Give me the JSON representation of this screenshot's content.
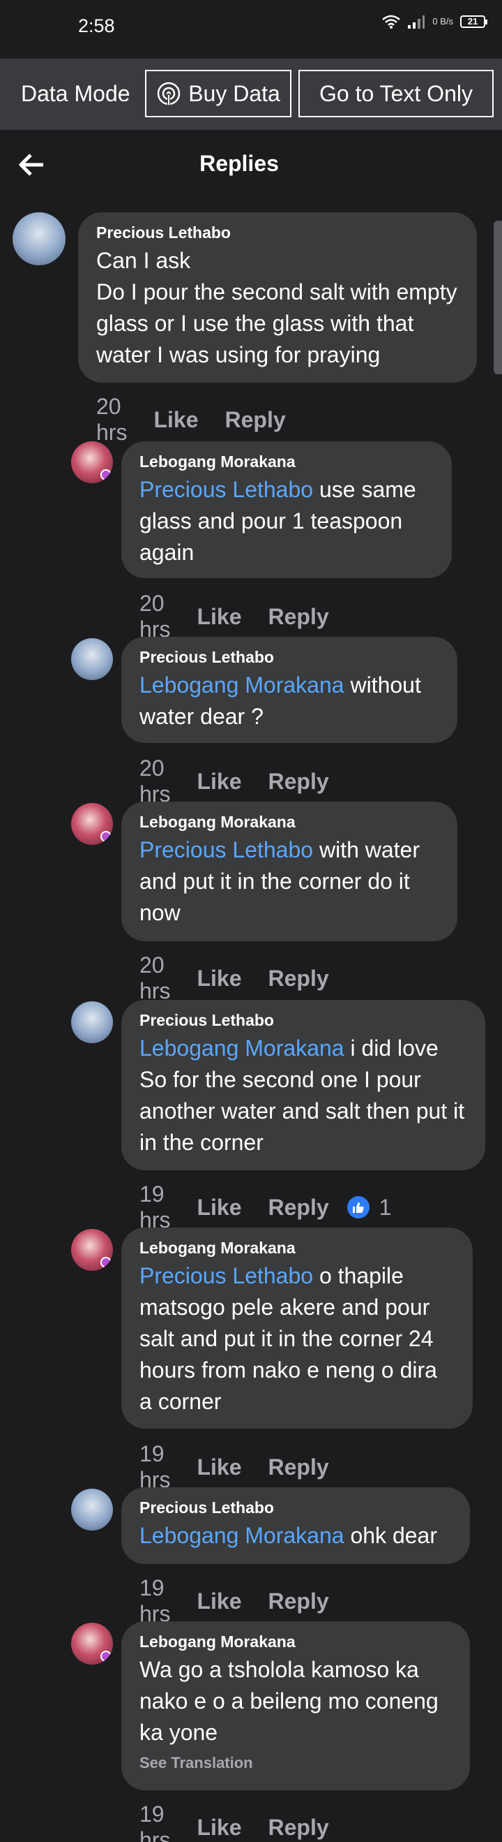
{
  "status_bar": {
    "time": "2:58",
    "net_speed": "0 B/s",
    "battery": "21"
  },
  "data_bar": {
    "mode_label": "Data Mode",
    "buy_data": "Buy Data",
    "text_only": "Go to Text Only"
  },
  "header": {
    "title": "Replies"
  },
  "comments": [
    {
      "author": "Precious Lethabo",
      "mention": "",
      "text_lines": [
        "Can I ask",
        "Do I pour the second salt with empty glass or I use the glass with that water I was using for praying"
      ],
      "time": "20 hrs",
      "like": "Like",
      "reply": "Reply"
    },
    {
      "author": "Lebogang Morakana",
      "mention": "Precious Lethabo",
      "text": " use same glass and pour 1 teaspoon again",
      "time": "20 hrs",
      "like": "Like",
      "reply": "Reply"
    },
    {
      "author": "Precious Lethabo",
      "mention": "Lebogang Morakana",
      "text": " without water dear ?",
      "time": "20 hrs",
      "like": "Like",
      "reply": "Reply"
    },
    {
      "author": "Lebogang Morakana",
      "mention": "Precious Lethabo",
      "text": " with water and put it in the corner do it now",
      "time": "20 hrs",
      "like": "Like",
      "reply": "Reply"
    },
    {
      "author": "Precious Lethabo",
      "mention": "Lebogang Morakana",
      "text": " i did love",
      "text2": "So for the second one I pour another water and salt then put it in the corner",
      "time": "19 hrs",
      "like": "Like",
      "reply": "Reply",
      "reaction_count": "1"
    },
    {
      "author": "Lebogang Morakana",
      "mention": "Precious Lethabo",
      "text": " o thapile matsogo pele akere and pour salt and put it in the corner 24 hours from nako e neng o dira a corner",
      "time": "19 hrs",
      "like": "Like",
      "reply": "Reply"
    },
    {
      "author": "Precious Lethabo",
      "mention": "Lebogang Morakana",
      "text": " ohk dear",
      "time": "19 hrs",
      "like": "Like",
      "reply": "Reply"
    },
    {
      "author": "Lebogang Morakana",
      "mention": "",
      "text": "Wa go a tsholola kamoso ka nako e o a beileng mo coneng ka yone",
      "see_translation": "See Translation",
      "time": "19 hrs",
      "like": "Like",
      "reply": "Reply"
    }
  ],
  "colors": {
    "background": "#1c1c1e",
    "bubble": "#3a3b3c",
    "mention": "#5aa7ff",
    "meta": "#a8a9ad",
    "reaction": "#2d7cf6"
  },
  "icons": {
    "back": "arrow-left-icon",
    "buy_data": "signal-broadcast-icon",
    "reaction": "thumbs-up-icon",
    "wifi": "wifi-icon",
    "signal": "cell-signal-icon",
    "battery": "battery-icon"
  }
}
